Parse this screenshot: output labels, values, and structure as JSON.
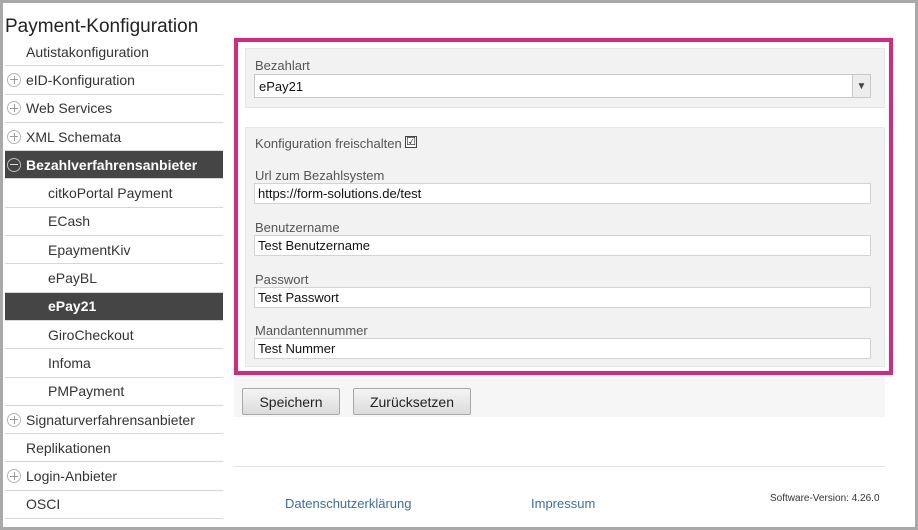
{
  "page_title": "Payment-Konfiguration",
  "sidebar": {
    "items": [
      {
        "label": "Autistakonfiguration",
        "level": 0,
        "toggle": "none",
        "active": false
      },
      {
        "label": "eID-Konfiguration",
        "level": 0,
        "toggle": "plus",
        "active": false
      },
      {
        "label": "Web Services",
        "level": 0,
        "toggle": "plus",
        "active": false
      },
      {
        "label": "XML Schemata",
        "level": 0,
        "toggle": "plus",
        "active": false
      },
      {
        "label": "Bezahlverfahrensanbieter",
        "level": 0,
        "toggle": "minus",
        "active": true
      },
      {
        "label": "citkoPortal Payment",
        "level": 1,
        "toggle": "none",
        "active": false
      },
      {
        "label": "ECash",
        "level": 1,
        "toggle": "none",
        "active": false
      },
      {
        "label": "EpaymentKiv",
        "level": 1,
        "toggle": "none",
        "active": false
      },
      {
        "label": "ePayBL",
        "level": 1,
        "toggle": "none",
        "active": false
      },
      {
        "label": "ePay21",
        "level": 1,
        "toggle": "none",
        "active": true
      },
      {
        "label": "GiroCheckout",
        "level": 1,
        "toggle": "none",
        "active": false
      },
      {
        "label": "Infoma",
        "level": 1,
        "toggle": "none",
        "active": false
      },
      {
        "label": "PMPayment",
        "level": 1,
        "toggle": "none",
        "active": false
      },
      {
        "label": "Signaturverfahrensanbieter",
        "level": 0,
        "toggle": "plus",
        "active": false
      },
      {
        "label": "Replikationen",
        "level": 0,
        "toggle": "none",
        "active": false
      },
      {
        "label": "Login-Anbieter",
        "level": 0,
        "toggle": "plus",
        "active": false
      },
      {
        "label": "OSCI",
        "level": 0,
        "toggle": "none",
        "active": false
      }
    ]
  },
  "form": {
    "bezahlart_label": "Bezahlart",
    "bezahlart_value": "ePay21",
    "freischalten_label": "Konfiguration freischalten",
    "freischalten_checked": "☑",
    "url_label": "Url zum Bezahlsystem",
    "url_value": "https://form-solutions.de/test",
    "user_label": "Benutzername",
    "user_value": "Test Benutzername",
    "pass_label": "Passwort",
    "pass_value": "Test Passwort",
    "mandant_label": "Mandantennummer",
    "mandant_value": "Test Nummer"
  },
  "buttons": {
    "save": "Speichern",
    "reset": "Zurücksetzen"
  },
  "footer": {
    "privacy": "Datenschutzerklärung",
    "imprint": "Impressum",
    "version": "Software-Version: 4.26.0"
  },
  "colors": {
    "highlight": "#d6287f",
    "active_nav": "#454545",
    "link": "#3a6ea5"
  }
}
